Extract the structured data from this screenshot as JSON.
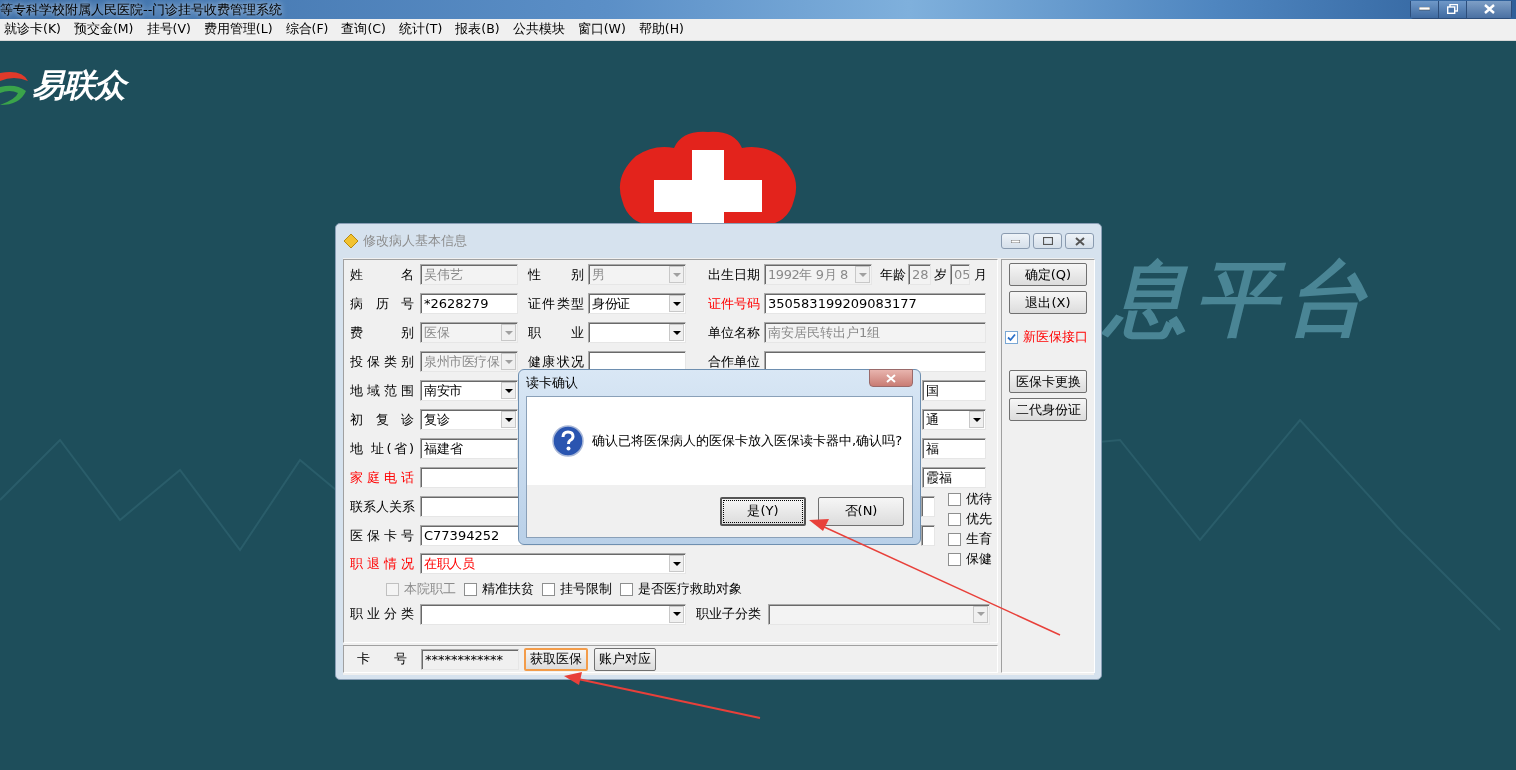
{
  "app_window": {
    "title": "等专科学校附属人民医院--门诊挂号收费管理系统"
  },
  "menu": [
    "就诊卡(K)",
    "预交金(M)",
    "挂号(V)",
    "费用管理(L)",
    "综合(F)",
    "查询(C)",
    "统计(T)",
    "报表(B)",
    "公共模块",
    "窗口(W)",
    "帮助(H)"
  ],
  "desktop": {
    "logo_text": "易联众",
    "wallpaper_text": "息平台"
  },
  "dialog": {
    "title": "修改病人基本信息",
    "rows": [
      {
        "items": [
          {
            "kind": "label",
            "text": "姓名",
            "highlight": false
          },
          {
            "kind": "text",
            "value": "吴伟艺",
            "disabled": true,
            "highlight": false
          },
          {
            "kind": "label",
            "text": "性别",
            "highlight": false
          },
          {
            "kind": "combo",
            "value": "男",
            "disabled": true,
            "highlight": false
          },
          {
            "kind": "label",
            "text": "出生日期",
            "highlight": false
          },
          {
            "kind": "combo",
            "value": "1992年 9月 8",
            "disabled": true,
            "highlight": false
          },
          {
            "kind": "label",
            "text": "年龄",
            "highlight": false
          },
          {
            "kind": "text",
            "value": "28",
            "disabled": true,
            "highlight": false
          },
          {
            "kind": "label",
            "text": "岁",
            "highlight": false
          },
          {
            "kind": "text",
            "value": "05",
            "disabled": true,
            "highlight": false
          },
          {
            "kind": "label",
            "text": "月",
            "highlight": false
          }
        ]
      },
      {
        "items": [
          {
            "kind": "label",
            "text": "病历号",
            "highlight": false
          },
          {
            "kind": "text",
            "value": "*2628279",
            "disabled": false,
            "highlight": false
          },
          {
            "kind": "label",
            "text": "证件类型",
            "highlight": false
          },
          {
            "kind": "combo",
            "value": "身份证",
            "disabled": false,
            "highlight": false
          },
          {
            "kind": "label",
            "text": "证件号码",
            "highlight": true
          },
          {
            "kind": "text",
            "value": "350583199209083177",
            "disabled": false,
            "highlight": false
          }
        ]
      },
      {
        "items": [
          {
            "kind": "label",
            "text": "费别",
            "highlight": false
          },
          {
            "kind": "combo",
            "value": "医保",
            "disabled": true,
            "highlight": false
          },
          {
            "kind": "label",
            "text": "职业",
            "highlight": false
          },
          {
            "kind": "combo",
            "disabled": false
          },
          {
            "kind": "label",
            "text": "单位名称",
            "highlight": false
          },
          {
            "kind": "text",
            "value": "南安居民转出户1组",
            "disabled": true,
            "highlight": false
          }
        ]
      },
      {
        "items": [
          {
            "kind": "label",
            "text": "投保类别",
            "highlight": false
          },
          {
            "kind": "combo",
            "value": "泉州市医疗保",
            "disabled": true,
            "highlight": false
          },
          {
            "kind": "label",
            "text": "健康状况",
            "highlight": false
          },
          {
            "kind": "text",
            "disabled": false
          },
          {
            "kind": "label",
            "text": "合作单位",
            "highlight": false
          },
          {
            "kind": "text",
            "disabled": false
          }
        ]
      },
      {
        "items": [
          {
            "kind": "label",
            "text": "地域范围",
            "highlight": false
          },
          {
            "kind": "combo",
            "value": "南安市",
            "disabled": false,
            "highlight": false
          },
          {
            "kind": "text",
            "value": "国",
            "disabled": false,
            "highlight": false
          }
        ]
      },
      {
        "items": [
          {
            "kind": "label",
            "text": "初复诊",
            "highlight": false
          },
          {
            "kind": "combo",
            "value": "复诊",
            "disabled": false,
            "highlight": false
          },
          {
            "kind": "combo",
            "value": "通",
            "disabled": false,
            "highlight": false
          }
        ]
      },
      {
        "items": [
          {
            "kind": "label",
            "text": "地 址(省)",
            "highlight": false
          },
          {
            "kind": "text",
            "value": "福建省",
            "disabled": false,
            "highlight": false
          },
          {
            "kind": "text",
            "value": "福",
            "disabled": false,
            "highlight": false
          }
        ]
      },
      {
        "items": [
          {
            "kind": "label",
            "text": "家庭电话",
            "highlight": true
          },
          {
            "kind": "text",
            "disabled": false
          },
          {
            "kind": "text",
            "value": "霞福",
            "disabled": false,
            "highlight": false
          }
        ]
      },
      {
        "items": [
          {
            "kind": "label",
            "text": "联系人关系",
            "highlight": false
          },
          {
            "kind": "text",
            "disabled": false
          },
          {
            "kind": "text",
            "disabled": false
          }
        ]
      },
      {
        "items": [
          {
            "kind": "label",
            "text": "医保卡号",
            "highlight": false
          },
          {
            "kind": "text",
            "value": "C77394252",
            "disabled": false,
            "highlight": false
          },
          {
            "kind": "text",
            "disabled": false
          }
        ]
      },
      {
        "items": [
          {
            "kind": "label",
            "text": "职退情况",
            "highlight": true
          },
          {
            "kind": "combo",
            "value": "在职人员",
            "disabled": false,
            "highlight": true
          }
        ]
      },
      {
        "items": [
          {
            "kind": "checkbox",
            "text": "本院职工",
            "checked": false,
            "disabled": true
          },
          {
            "kind": "checkbox",
            "text": "精准扶贫",
            "checked": false,
            "disabled": false
          },
          {
            "kind": "checkbox",
            "text": "挂号限制",
            "checked": false,
            "disabled": false
          },
          {
            "kind": "checkbox",
            "text": "是否医疗救助对象",
            "checked": false,
            "disabled": false
          }
        ]
      },
      {
        "items": [
          {
            "kind": "label",
            "text": "职业分类",
            "highlight": false
          },
          {
            "kind": "combo",
            "disabled": false
          },
          {
            "kind": "label",
            "text": "职业子分类",
            "highlight": false
          },
          {
            "kind": "combo",
            "disabled": true
          }
        ]
      }
    ],
    "side_checks": [
      {
        "text": "优待",
        "checked": false
      },
      {
        "text": "优先",
        "checked": false
      },
      {
        "text": "生育",
        "checked": false
      },
      {
        "text": "保健",
        "checked": false
      }
    ],
    "card": {
      "label": "卡号",
      "value": "************",
      "buttons": [
        {
          "label": "获取医保",
          "focused": true
        },
        {
          "label": "账户对应",
          "focused": false
        }
      ]
    },
    "side_top_buttons": [
      {
        "label": "确定(Q)"
      },
      {
        "label": "退出(X)"
      }
    ],
    "new_interface": {
      "text": "新医保接口",
      "checked": true
    },
    "side_bottom_buttons": [
      {
        "label": "医保卡更换"
      },
      {
        "label": "二代身份证"
      }
    ]
  },
  "message_box": {
    "title": "读卡确认",
    "message": "确认已将医保病人的医保卡放入医保读卡器中,确认吗?",
    "buttons": [
      {
        "label": "是(Y)",
        "focused": true
      },
      {
        "label": "否(N)",
        "focused": false
      }
    ]
  }
}
